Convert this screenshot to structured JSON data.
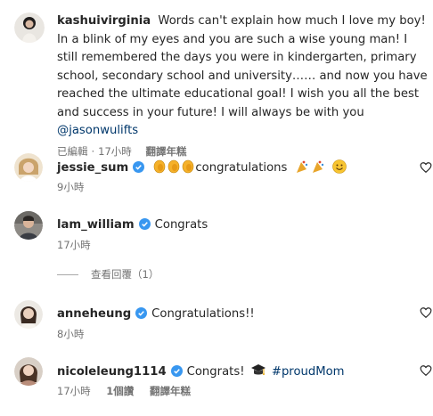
{
  "caption": {
    "username": "kashuivirginia",
    "text": "Words can't explain how much I love my boy! In a blink of my eyes and you are such a wise young man! I still remembered the days you were in kindergarten, primary school, secondary school and university…… and now you have reached the ultimate educational goal! I wish you all the best and success in your future! I will always be with you",
    "mention": "@jasonwulifts",
    "edited": "已編輯",
    "time": "17小時",
    "translate": "翻譯年糕"
  },
  "comments": [
    {
      "username": "jessie_sum",
      "text": "congratulations",
      "time": "9小時"
    },
    {
      "username": "lam_william",
      "text": "Congrats",
      "time": "17小時",
      "replies_label": "查看回覆（1）"
    },
    {
      "username": "anneheung",
      "text": "Congratulations!!",
      "time": "8小時"
    },
    {
      "username": "nicoleleung1114",
      "text": "Congrats!",
      "hashtag": "#proudMom",
      "time": "17小時",
      "likes": "1個讚",
      "translate": "翻譯年糕"
    }
  ],
  "colors": {
    "verified": "#3897f0",
    "link": "#00376b",
    "meta": "#737373"
  }
}
